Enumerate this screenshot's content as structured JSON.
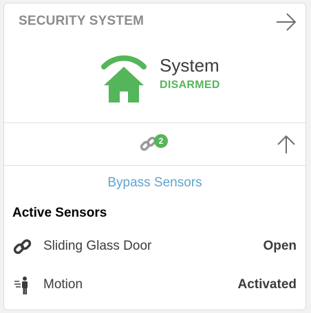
{
  "header": {
    "title": "SECURITY SYSTEM",
    "arrow_icon": "arrow-right-icon"
  },
  "status": {
    "icon": "house-wifi-icon",
    "label": "System",
    "state": "DISARMED"
  },
  "sensor_bar": {
    "icon": "link-icon",
    "badge_count": "2",
    "collapse_icon": "arrow-up-icon"
  },
  "bypass_label": "Bypass Sensors",
  "active_sensors": {
    "title": "Active Sensors",
    "items": [
      {
        "name": "Sliding Glass Door",
        "status": "Open",
        "icon": "link-icon"
      },
      {
        "name": "Motion",
        "status": "Activated",
        "icon": "motion-person-icon"
      }
    ]
  },
  "colors": {
    "accent_green": "#55b55a",
    "link_blue": "#5fa4cf",
    "title_gray": "#8c8c8c",
    "text_dark": "#3c3c3c"
  }
}
